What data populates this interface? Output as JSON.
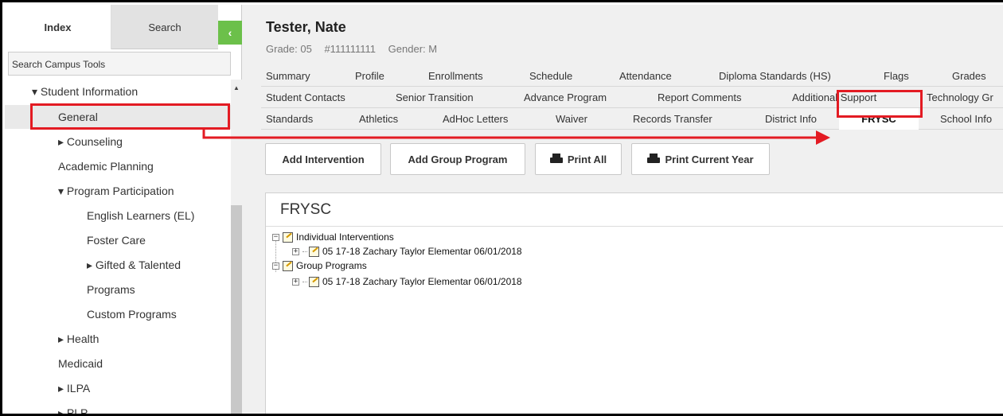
{
  "sidebar": {
    "tabs": {
      "index": "Index",
      "search": "Search"
    },
    "collapse_glyph": "‹",
    "search_tools": "Search Campus Tools",
    "tree": [
      {
        "label": "▾ Student Information",
        "indent": 34
      },
      {
        "label": "General",
        "indent": 67
      },
      {
        "label": "▸ Counseling",
        "indent": 67
      },
      {
        "label": "Academic Planning",
        "indent": 67
      },
      {
        "label": "▾ Program Participation",
        "indent": 67
      },
      {
        "label": "English Learners (EL)",
        "indent": 103
      },
      {
        "label": "Foster Care",
        "indent": 103
      },
      {
        "label": "▸ Gifted & Talented",
        "indent": 103
      },
      {
        "label": "Programs",
        "indent": 103
      },
      {
        "label": "Custom Programs",
        "indent": 103
      },
      {
        "label": "▸ Health",
        "indent": 67
      },
      {
        "label": "Medicaid",
        "indent": 67
      },
      {
        "label": "▸ ILPA",
        "indent": 67
      },
      {
        "label": "▸ PLP",
        "indent": 67
      }
    ]
  },
  "student": {
    "name": "Tester, Nate",
    "grade": "Grade: 05",
    "id": "#111111111",
    "gender": "Gender: M"
  },
  "tabs": {
    "row1": [
      "Summary",
      "Profile",
      "Enrollments",
      "Schedule",
      "Attendance",
      "Diploma Standards (HS)",
      "Flags",
      "Grades"
    ],
    "row2": [
      "Student Contacts",
      "Senior Transition",
      "Advance Program",
      "Report Comments",
      "Additional Support",
      "Technology Gr"
    ],
    "row3": [
      "Standards",
      "Athletics",
      "AdHoc Letters",
      "Waiver",
      "Records Transfer",
      "District Info",
      "FRYSC",
      "School Info"
    ]
  },
  "buttons": {
    "add_intervention": "Add Intervention",
    "add_group_program": "Add Group Program",
    "print_all": "Print All",
    "print_current_year": "Print Current Year"
  },
  "panel": {
    "title": "FRYSC",
    "tree": {
      "individual": "Individual Interventions",
      "individual_item": "05 17-18 Zachary Taylor Elementar 06/01/2018",
      "group": "Group Programs",
      "group_item": "05 17-18 Zachary Taylor Elementar 06/01/2018"
    }
  },
  "colors": {
    "accent_green": "#6cc04a",
    "highlight_red": "#e31b23"
  }
}
